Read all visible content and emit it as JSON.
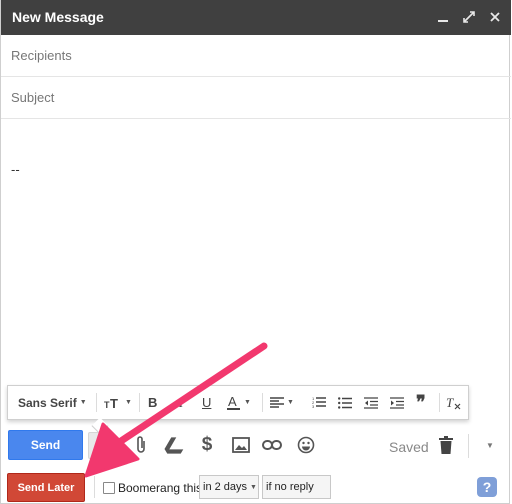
{
  "window": {
    "title": "New Message",
    "controls": [
      "minimize-icon",
      "expand-icon",
      "close-icon"
    ]
  },
  "fields": {
    "recipients_placeholder": "Recipients",
    "subject_placeholder": "Subject"
  },
  "body": {
    "signature": "--"
  },
  "format_toolbar": {
    "font_family": "Sans Serif",
    "icons": [
      "text-size-icon",
      "bold-icon",
      "italic-icon",
      "underline-icon",
      "text-color-icon",
      "align-icon",
      "numbered-list-icon",
      "bulleted-list-icon",
      "indent-less-icon",
      "indent-more-icon",
      "quote-icon",
      "remove-formatting-icon"
    ]
  },
  "bottom_toolbar": {
    "send_label": "Send",
    "saved_label": "Saved",
    "icons": [
      "formatting-icon",
      "attach-icon",
      "drive-icon",
      "money-icon",
      "photo-icon",
      "link-icon",
      "emoji-icon",
      "trash-icon",
      "more-options-icon"
    ]
  },
  "boomerang": {
    "send_later_label": "Send Later",
    "checkbox_label": "Boomerang this",
    "when_value": "in 2 days",
    "condition_value": "if no reply",
    "help_label": "?"
  },
  "colors": {
    "title_bar": "#404040",
    "send_button": "#4a87ee",
    "send_later_button": "#d14836",
    "annotation_arrow": "#f2386e"
  }
}
